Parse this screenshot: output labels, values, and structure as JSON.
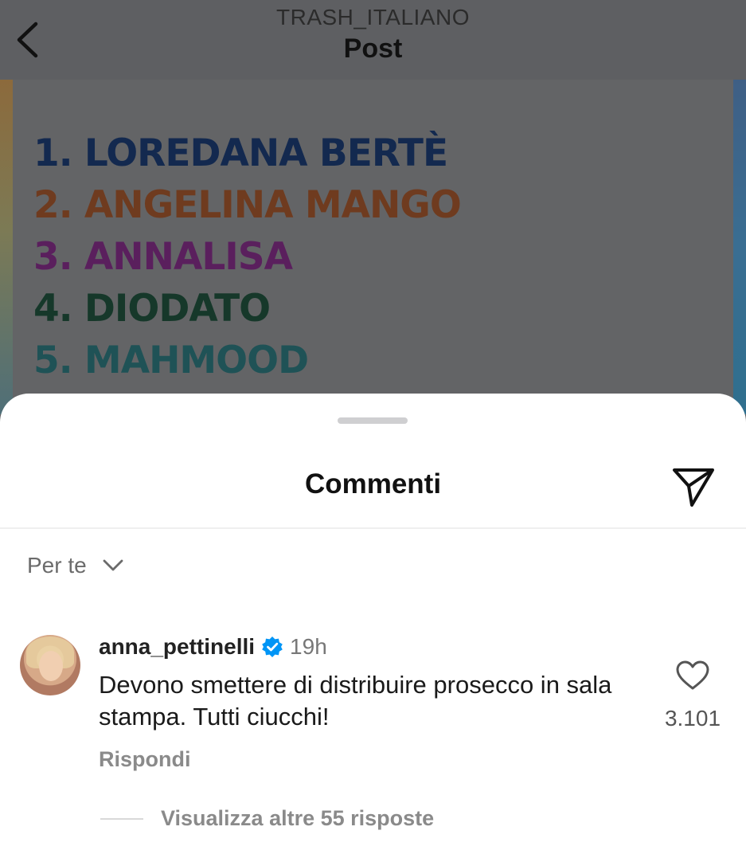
{
  "header": {
    "account": "TRASH_ITALIANO",
    "title": "Post"
  },
  "post": {
    "ranking": [
      {
        "text": "1. LOREDANA BERTÈ",
        "color": "#13294f"
      },
      {
        "text": "2. ANGELINA MANGO",
        "color": "#6f3b1f"
      },
      {
        "text": "3. ANNALISA",
        "color": "#5a1f5d"
      },
      {
        "text": "4. DIODATO",
        "color": "#16382a"
      },
      {
        "text": "5. MAHMOOD",
        "color": "#1f5256"
      }
    ]
  },
  "sheet": {
    "title": "Commenti",
    "sort_label": "Per te"
  },
  "comment": {
    "username": "anna_pettinelli",
    "verified": true,
    "time": "19h",
    "text": "Devono smettere di distribuire prosecco in sala stampa. Tutti ciucchi!",
    "reply_label": "Rispondi",
    "likes": "3.101",
    "view_replies": "Visualizza altre 55 risposte"
  },
  "colors": {
    "verified_badge": "#0095f6",
    "overlay": "#5f6063"
  }
}
